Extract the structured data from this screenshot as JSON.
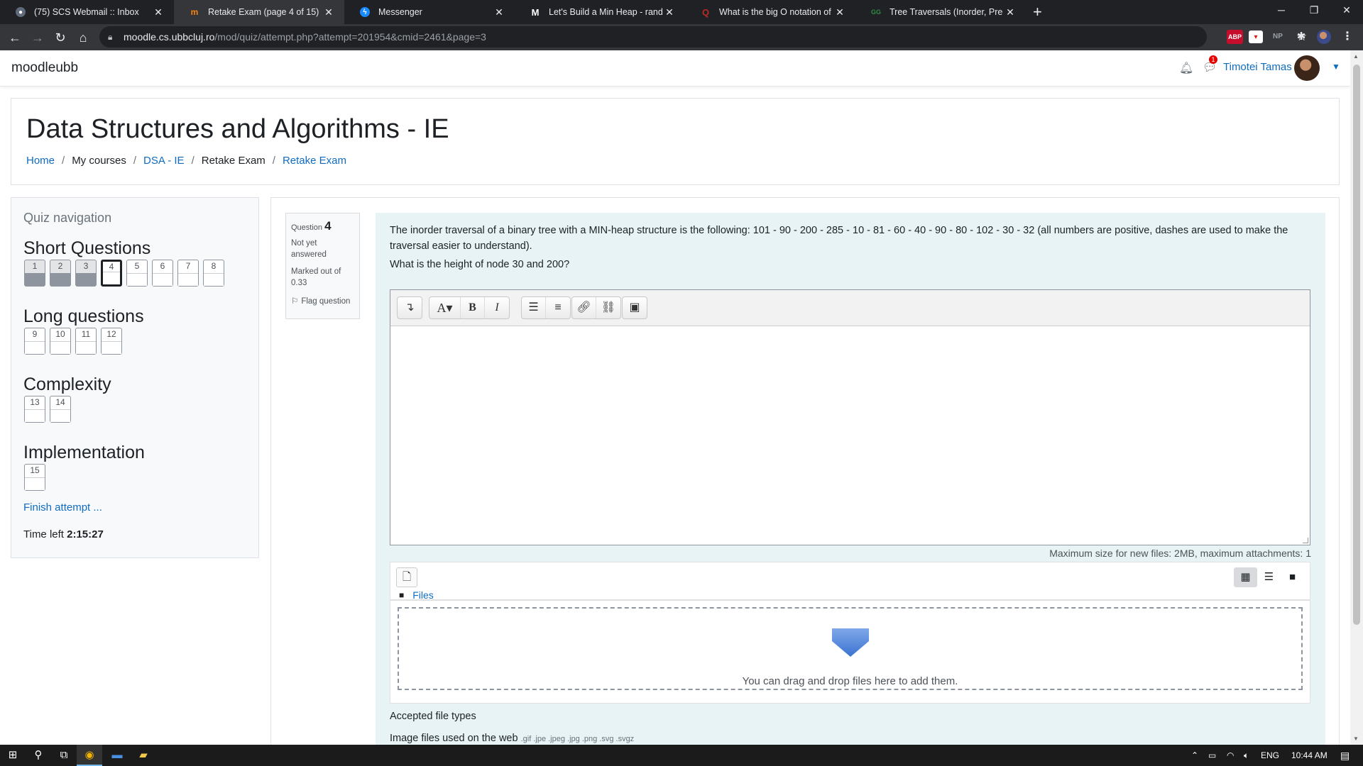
{
  "browser": {
    "tabs": [
      {
        "title": "(75) SCS Webmail :: Inbox",
        "icon": "webmail-icon",
        "active": false
      },
      {
        "title": "Retake Exam (page 4 of 15)",
        "icon": "moodle-icon",
        "active": true
      },
      {
        "title": "Messenger",
        "icon": "messenger-icon",
        "active": false
      },
      {
        "title": "Let's Build a Min Heap - randerso",
        "icon": "medium-icon",
        "active": false
      },
      {
        "title": "What is the big O notation of [m",
        "icon": "quora-icon",
        "active": false
      },
      {
        "title": "Tree Traversals (Inorder, Preorder",
        "icon": "gfg-icon",
        "active": false
      }
    ],
    "url_host": "moodle.cs.ubbcluj.ro",
    "url_path": "/mod/quiz/attempt.php?attempt=201954&cmid=2461&page=3",
    "extensions": [
      "ABP",
      "NP"
    ]
  },
  "header": {
    "brand": "moodleubb",
    "user_name": "Timotei Tamas",
    "message_count": "1"
  },
  "page": {
    "title": "Data Structures and Algorithms - IE",
    "breadcrumb": [
      {
        "label": "Home",
        "link": true
      },
      {
        "label": "My courses",
        "link": false
      },
      {
        "label": "DSA - IE",
        "link": true
      },
      {
        "label": "Retake Exam",
        "link": false
      },
      {
        "label": "Retake Exam",
        "link": true
      }
    ]
  },
  "quiz_nav": {
    "title": "Quiz navigation",
    "sections": [
      {
        "heading": "Short Questions",
        "questions": [
          {
            "n": "1",
            "state": "answered"
          },
          {
            "n": "2",
            "state": "answered"
          },
          {
            "n": "3",
            "state": "answered"
          },
          {
            "n": "4",
            "state": "current"
          },
          {
            "n": "5",
            "state": "empty"
          },
          {
            "n": "6",
            "state": "empty"
          },
          {
            "n": "7",
            "state": "empty"
          },
          {
            "n": "8",
            "state": "empty"
          }
        ]
      },
      {
        "heading": "Long questions",
        "questions": [
          {
            "n": "9",
            "state": "empty"
          },
          {
            "n": "10",
            "state": "empty"
          },
          {
            "n": "11",
            "state": "empty"
          },
          {
            "n": "12",
            "state": "empty"
          }
        ]
      },
      {
        "heading": "Complexity",
        "questions": [
          {
            "n": "13",
            "state": "empty"
          },
          {
            "n": "14",
            "state": "empty"
          }
        ]
      },
      {
        "heading": "Implementation",
        "questions": [
          {
            "n": "15",
            "state": "empty"
          }
        ]
      }
    ],
    "finish_label": "Finish attempt ...",
    "time_left_label": "Time left",
    "time_left": "2:15:27"
  },
  "question": {
    "label": "Question",
    "number": "4",
    "state": "Not yet answered",
    "marked_out_of": "Marked out of 0.33",
    "flag_label": "Flag question",
    "text": "The inorder traversal of a binary tree with a MIN-heap structure is the following: 101 - 90 - 200 - 285 - 10 - 81 - 60 - 40 - 90 - 80 - 102 - 30 - 32  (all numbers are positive, dashes are used to make the traversal easier to understand).",
    "subtext": "What is the height of node 30 and 200?",
    "editor_content": ""
  },
  "files": {
    "max_size": "Maximum size for new files: 2MB, maximum attachments: 1",
    "folder_label": "Files",
    "drop_text": "You can drag and drop files here to add them.",
    "accepted_label": "Accepted file types",
    "image_files_label": "Image files used on the web",
    "image_extensions": ".gif .jpe .jpeg .jpg .png .svg .svgz"
  },
  "taskbar": {
    "lang": "ENG",
    "time": "10:44 AM"
  },
  "colors": {
    "link": "#0f6cbf",
    "question_bg": "#e7f3f5",
    "answered_fill": "#8f959e"
  }
}
